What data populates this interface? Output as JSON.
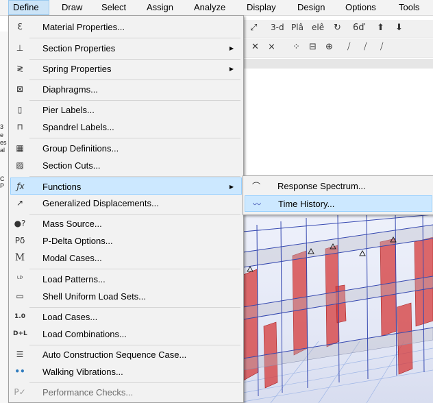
{
  "menubar": {
    "items": [
      "Define",
      "Draw",
      "Select",
      "Assign",
      "Analyze",
      "Display",
      "Design",
      "Options",
      "Tools"
    ],
    "active": "Define"
  },
  "toolbar": {
    "row1": [
      "⤢",
      "3-d",
      "Plâ",
      "elê",
      "↻",
      "6ď",
      "⬆",
      "⬇"
    ],
    "row2": [
      "✕",
      "⨯",
      "⁘",
      "⊟",
      "⊕",
      "⧸",
      "⧸",
      "⧸"
    ]
  },
  "left_edge_text": [
    "3",
    "e",
    "es",
    "al",
    "C",
    "P"
  ],
  "menu": {
    "items": [
      {
        "label": "Material Properties...",
        "icon": "material-icon",
        "glyph": "Ɛ"
      },
      {
        "label": "Section Properties",
        "icon": "section-icon",
        "glyph": "⊥",
        "submenu": true
      },
      {
        "label": "Spring Properties",
        "icon": "spring-icon",
        "glyph": "≷",
        "submenu": true
      },
      {
        "label": "Diaphragms...",
        "icon": "diaphragm-icon",
        "glyph": "⊠"
      },
      {
        "label": "Pier Labels...",
        "icon": "pier-icon",
        "glyph": "▯"
      },
      {
        "label": "Spandrel Labels...",
        "icon": "spandrel-icon",
        "glyph": "⊓"
      },
      {
        "label": "Group Definitions...",
        "icon": "group-icon",
        "glyph": "▦"
      },
      {
        "label": "Section Cuts...",
        "icon": "section-cut-icon",
        "glyph": "▨"
      },
      {
        "label": "Functions",
        "icon": "function-icon",
        "glyph": "ƒx",
        "submenu": true,
        "highlighted": true
      },
      {
        "label": "Generalized Displacements...",
        "icon": "displacement-icon",
        "glyph": "↗"
      },
      {
        "label": "Mass Source...",
        "icon": "mass-icon",
        "glyph": "●?"
      },
      {
        "label": "P-Delta Options...",
        "icon": "pdelta-icon",
        "glyph": "Pδ"
      },
      {
        "label": "Modal Cases...",
        "icon": "modal-icon",
        "glyph": "M"
      },
      {
        "label": "Load Patterns...",
        "icon": "load-pattern-icon",
        "glyph": "ᴸᴰ"
      },
      {
        "label": "Shell Uniform Load Sets...",
        "icon": "shell-load-icon",
        "glyph": "▭"
      },
      {
        "label": "Load Cases...",
        "icon": "load-case-icon",
        "glyph": "1.0"
      },
      {
        "label": "Load Combinations...",
        "icon": "load-combo-icon",
        "glyph": "D+L"
      },
      {
        "label": "Auto Construction Sequence Case...",
        "icon": "construction-icon",
        "glyph": "☰"
      },
      {
        "label": "Walking Vibrations...",
        "icon": "footsteps-icon",
        "glyph": "••"
      },
      {
        "label": "Performance Checks...",
        "icon": "performance-icon",
        "glyph": "P✓",
        "disabled": true
      }
    ]
  },
  "submenu": {
    "items": [
      {
        "label": "Response Spectrum...",
        "icon": "response-spectrum-icon",
        "glyph": "⌒"
      },
      {
        "label": "Time History...",
        "icon": "time-history-icon",
        "glyph": "〰",
        "highlighted": true
      }
    ]
  },
  "colors": {
    "highlight": "#cce8ff",
    "highlight_border": "#99d1ff",
    "menu_bg": "#f2f2f2",
    "wall_red": "#d63a3a",
    "frame_blue": "#3548b0"
  }
}
